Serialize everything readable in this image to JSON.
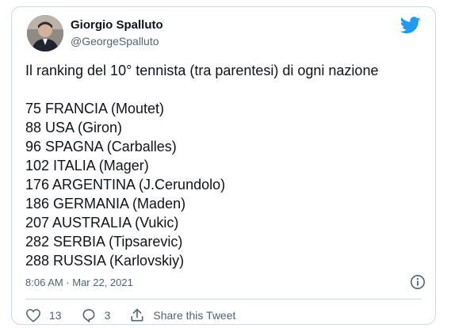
{
  "author": {
    "name": "Giorgio Spalluto",
    "handle": "@GeorgeSpalluto"
  },
  "tweet": {
    "intro": "Il ranking del 10° tennista (tra parentesi) di ogni nazione",
    "lines": [
      "75 FRANCIA (Moutet)",
      "88 USA (Giron)",
      "96 SPAGNA (Carballes)",
      "102 ITALIA (Mager)",
      "176 ARGENTINA (J.Cerundolo)",
      "186 GERMANIA (Maden)",
      "207 AUSTRALIA (Vukic)",
      "282 SERBIA (Tipsarevic)",
      "288 RUSSIA (Karlovskiy)"
    ],
    "timestamp": "8:06 AM · Mar 22, 2021"
  },
  "actions": {
    "likes": "13",
    "replies": "3",
    "share_label": "Share this Tweet"
  },
  "colors": {
    "brand": "#1d9bf0",
    "secondary_text": "#536471",
    "border": "#cfd9de"
  },
  "icons": [
    "twitter-bird-icon",
    "info-icon",
    "heart-icon",
    "reply-icon",
    "share-icon"
  ]
}
